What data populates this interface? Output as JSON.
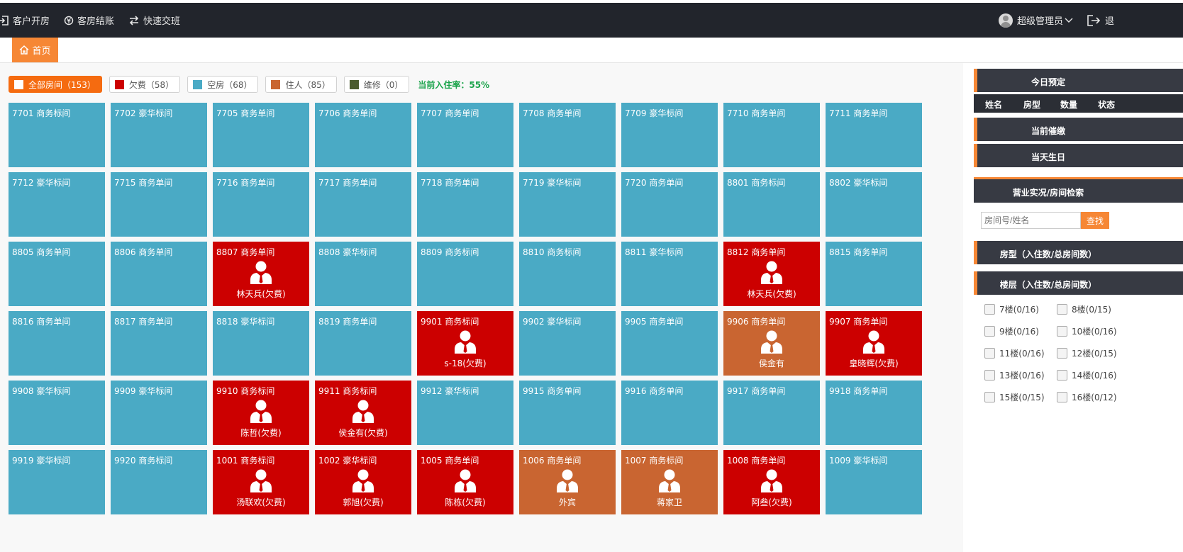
{
  "topnav": {
    "items": [
      {
        "label": "客户开房",
        "icon": "enter-icon"
      },
      {
        "label": "客房结账",
        "icon": "money-icon"
      },
      {
        "label": "快速交班",
        "icon": "swap-icon"
      }
    ],
    "user": "超级管理员",
    "logout": "退"
  },
  "tabs": {
    "home": "首页"
  },
  "filters": [
    {
      "label": "全部房间（153）",
      "color": "#ffffff",
      "active": true
    },
    {
      "label": "欠费（58）",
      "color": "#cc0000"
    },
    {
      "label": "空房（68）",
      "color": "#4aaac5"
    },
    {
      "label": "住人（85）",
      "color": "#c96531"
    },
    {
      "label": "维修（0）",
      "color": "#4b5b2e"
    }
  ],
  "occupancy": "当前入住率：55%",
  "colors": {
    "vacant": "#4aaac5",
    "arrears": "#cc0000",
    "occupied": "#c96531",
    "accent": "#f68735",
    "topbar": "#22252c"
  },
  "rooms": [
    {
      "title": "7701 商务标间",
      "status": "vacant"
    },
    {
      "title": "7702 豪华标间",
      "status": "vacant"
    },
    {
      "title": "7705 商务单间",
      "status": "vacant"
    },
    {
      "title": "7706 商务单间",
      "status": "vacant"
    },
    {
      "title": "7707 商务单间",
      "status": "vacant"
    },
    {
      "title": "7708 商务单间",
      "status": "vacant"
    },
    {
      "title": "7709 豪华标间",
      "status": "vacant"
    },
    {
      "title": "7710 商务单间",
      "status": "vacant"
    },
    {
      "title": "7711 商务单间",
      "status": "vacant"
    },
    {
      "title": "7712 豪华标间",
      "status": "vacant"
    },
    {
      "title": "7715 商务单间",
      "status": "vacant"
    },
    {
      "title": "7716 商务单间",
      "status": "vacant"
    },
    {
      "title": "7717 商务单间",
      "status": "vacant"
    },
    {
      "title": "7718 商务单间",
      "status": "vacant"
    },
    {
      "title": "7719 豪华标间",
      "status": "vacant"
    },
    {
      "title": "7720 商务单间",
      "status": "vacant"
    },
    {
      "title": "8801 商务标间",
      "status": "vacant"
    },
    {
      "title": "8802 豪华标间",
      "status": "vacant"
    },
    {
      "title": "8805 商务单间",
      "status": "vacant"
    },
    {
      "title": "8806 商务单间",
      "status": "vacant"
    },
    {
      "title": "8807 商务单间",
      "status": "arrears",
      "guest": "林天兵(欠费)"
    },
    {
      "title": "8808 豪华标间",
      "status": "vacant"
    },
    {
      "title": "8809 商务标间",
      "status": "vacant"
    },
    {
      "title": "8810 商务标间",
      "status": "vacant"
    },
    {
      "title": "8811 豪华标间",
      "status": "vacant"
    },
    {
      "title": "8812 商务单间",
      "status": "arrears",
      "guest": "林天兵(欠费)"
    },
    {
      "title": "8815 商务单间",
      "status": "vacant"
    },
    {
      "title": "8816 商务单间",
      "status": "vacant"
    },
    {
      "title": "8817 商务单间",
      "status": "vacant"
    },
    {
      "title": "8818 豪华标间",
      "status": "vacant"
    },
    {
      "title": "8819 商务单间",
      "status": "vacant"
    },
    {
      "title": "9901 商务标间",
      "status": "arrears",
      "guest": "s-18(欠费)"
    },
    {
      "title": "9902 豪华标间",
      "status": "vacant"
    },
    {
      "title": "9905 商务单间",
      "status": "vacant"
    },
    {
      "title": "9906 商务单间",
      "status": "occupied",
      "guest": "侯金有"
    },
    {
      "title": "9907 商务单间",
      "status": "arrears",
      "guest": "皇晓辉(欠费)"
    },
    {
      "title": "9908 豪华标间",
      "status": "vacant"
    },
    {
      "title": "9909 豪华标间",
      "status": "vacant"
    },
    {
      "title": "9910 商务标间",
      "status": "arrears",
      "guest": "陈哲(欠费)"
    },
    {
      "title": "9911 商务标间",
      "status": "arrears",
      "guest": "侯金有(欠费)"
    },
    {
      "title": "9912 豪华标间",
      "status": "vacant"
    },
    {
      "title": "9915 商务单间",
      "status": "vacant"
    },
    {
      "title": "9916 商务单间",
      "status": "vacant"
    },
    {
      "title": "9917 商务单间",
      "status": "vacant"
    },
    {
      "title": "9918 商务单间",
      "status": "vacant"
    },
    {
      "title": "9919 豪华标间",
      "status": "vacant"
    },
    {
      "title": "9920 商务标间",
      "status": "vacant"
    },
    {
      "title": "1001 商务标间",
      "status": "arrears",
      "guest": "汤联欢(欠费)"
    },
    {
      "title": "1002 豪华标间",
      "status": "arrears",
      "guest": "郭旭(欠费)"
    },
    {
      "title": "1005 商务单间",
      "status": "arrears",
      "guest": "陈栋(欠费)"
    },
    {
      "title": "1006 商务单间",
      "status": "occupied",
      "guest": "外宾"
    },
    {
      "title": "1007 商务标间",
      "status": "occupied",
      "guest": "蒋家卫"
    },
    {
      "title": "1008 商务单间",
      "status": "arrears",
      "guest": "阿叁(欠费)"
    },
    {
      "title": "1009 豪华标间",
      "status": "vacant"
    }
  ],
  "sidebar": {
    "today_booking": "今日预定",
    "booking_cols": [
      "姓名",
      "房型",
      "数量",
      "状态"
    ],
    "current_dunning": "当前催缴",
    "birthday": "当天生日",
    "business_search": "营业实况/房间检索",
    "search_placeholder": "房间号/姓名",
    "search_button": "查找",
    "room_type": "房型（入住数/总房间数）",
    "floor": "楼层（入住数/总房间数）",
    "floors": [
      "7楼(0/16)",
      "8楼(0/15)",
      "9楼(0/16)",
      "10楼(0/16)",
      "11楼(0/16)",
      "12楼(0/15)",
      "13楼(0/16)",
      "14楼(0/16)",
      "15楼(0/15)",
      "16楼(0/12)"
    ]
  }
}
